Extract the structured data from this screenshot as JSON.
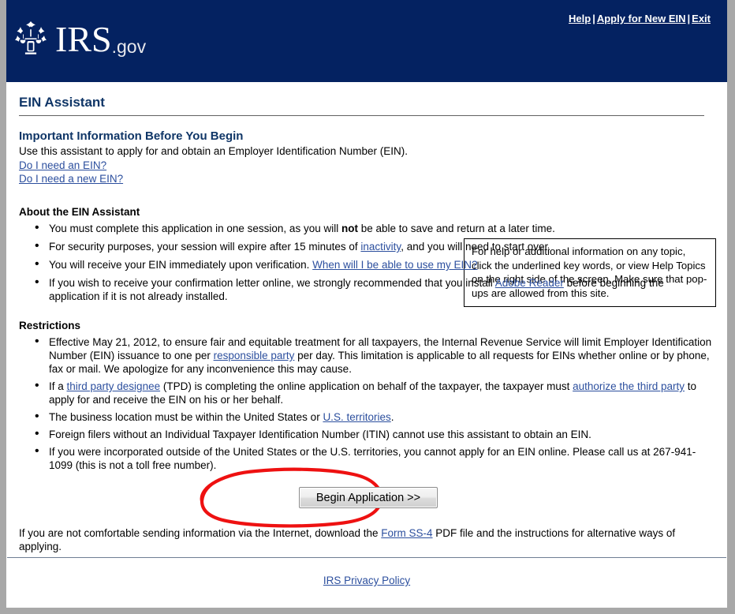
{
  "header": {
    "logo_icon": "irs-eagle-seal-icon",
    "wordmark": "IRS",
    "wordmark_suffix": ".gov",
    "nav": [
      {
        "label": "Help"
      },
      {
        "label": "Apply for New EIN"
      },
      {
        "label": "Exit"
      }
    ],
    "nav_separator": "|",
    "background_color": "#042261"
  },
  "page": {
    "title": "EIN Assistant",
    "title_color": "#103667",
    "link_color": "#2c4f9e"
  },
  "intro": {
    "heading": "Important Information Before You Begin",
    "description": "Use this assistant to apply for and obtain an Employer Identification Number (EIN).",
    "links": [
      {
        "label": "Do I need an EIN?"
      },
      {
        "label": "Do I need a new EIN?"
      }
    ]
  },
  "help_box": {
    "text": "For help or additional information on any topic, click the underlined key words, or view Help Topics on the right side of the screen. Make sure that pop-ups are allowed from this site."
  },
  "about": {
    "heading": "About the EIN Assistant",
    "bullets": [
      {
        "segments": [
          {
            "text": "You must complete this application in one session, as you will ",
            "type": "text"
          },
          {
            "text": "not",
            "type": "bold"
          },
          {
            "text": " be able to save and return at a later time.",
            "type": "text"
          }
        ]
      },
      {
        "segments": [
          {
            "text": "For security purposes, your session will expire after 15 minutes of ",
            "type": "text"
          },
          {
            "text": "inactivity",
            "type": "link"
          },
          {
            "text": ", and you will need to start over.",
            "type": "text"
          }
        ]
      },
      {
        "segments": [
          {
            "text": "You will receive your EIN immediately upon verification. ",
            "type": "text"
          },
          {
            "text": "When will I be able to use my EIN?",
            "type": "link"
          }
        ]
      },
      {
        "segments": [
          {
            "text": "If you wish to receive your confirmation letter online, we strongly recommended that you install ",
            "type": "text"
          },
          {
            "text": "Adobe Reader",
            "type": "link"
          },
          {
            "text": " before beginning the application if it is not already installed.",
            "type": "text"
          }
        ]
      }
    ]
  },
  "restrictions": {
    "heading": "Restrictions",
    "bullets": [
      {
        "segments": [
          {
            "text": "Effective May 21, 2012, to ensure fair and equitable treatment for all taxpayers, the Internal Revenue Service will limit Employer Identification Number (EIN) issuance to one per ",
            "type": "text"
          },
          {
            "text": "responsible party",
            "type": "link"
          },
          {
            "text": " per day. This limitation is applicable to all requests for EINs whether online or by phone, fax or mail.  We apologize for any inconvenience this may cause.",
            "type": "text"
          }
        ]
      },
      {
        "segments": [
          {
            "text": "If a ",
            "type": "text"
          },
          {
            "text": "third party designee",
            "type": "link"
          },
          {
            "text": " (TPD) is completing the online application on behalf of the taxpayer, the taxpayer must ",
            "type": "text"
          },
          {
            "text": "authorize the third party",
            "type": "link"
          },
          {
            "text": " to apply for and receive the EIN on his or her behalf.",
            "type": "text"
          }
        ]
      },
      {
        "segments": [
          {
            "text": "The business location must be within the United States or ",
            "type": "text"
          },
          {
            "text": "U.S. territories",
            "type": "link"
          },
          {
            "text": ".",
            "type": "text"
          }
        ]
      },
      {
        "segments": [
          {
            "text": "Foreign filers without an Individual Taxpayer Identification Number (ITIN) cannot use this assistant to obtain an EIN.",
            "type": "text"
          }
        ]
      },
      {
        "segments": [
          {
            "text": "If you were incorporated outside of the United States or the U.S. territories, you cannot apply for an EIN online. Please call us at 267-941-1099 (this is not a toll free number).",
            "type": "text"
          }
        ]
      }
    ]
  },
  "begin_button": {
    "label": "Begin Application >>"
  },
  "annotation": {
    "shape": "hand-drawn-red-ellipse",
    "color": "#ee1111"
  },
  "closing": {
    "segments": [
      {
        "text": "If you are not comfortable sending information via the Internet, download the ",
        "type": "text"
      },
      {
        "text": "Form SS-4",
        "type": "link"
      },
      {
        "text": " PDF file and the instructions for alternative ways of applying.",
        "type": "text"
      }
    ]
  },
  "footer": {
    "privacy_link": "IRS Privacy Policy"
  }
}
